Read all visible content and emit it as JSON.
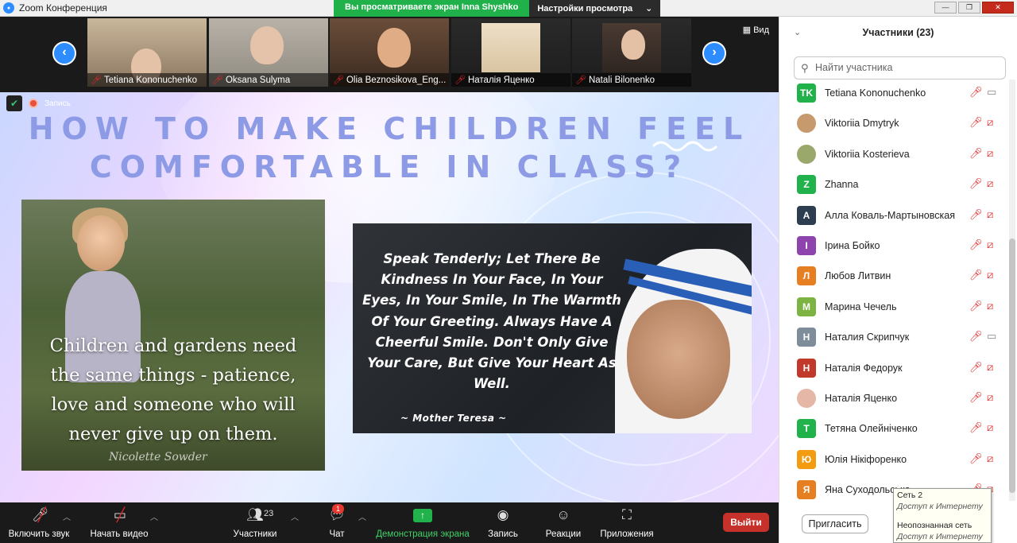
{
  "window": {
    "title": "Zoom Конференция",
    "sharing_banner": "Вы просматриваете экран Inna Shyshko",
    "view_options": "Настройки просмотра",
    "view_label": "Вид"
  },
  "video_strip": {
    "tiles": [
      {
        "name": "Tetiana Kononuchenko"
      },
      {
        "name": "Oksana Sulyma"
      },
      {
        "name": "Olia Beznosikova_Eng..."
      },
      {
        "name": "Наталія Яценко"
      },
      {
        "name": "Natali Bilonenko"
      }
    ]
  },
  "recording_label": "Запись",
  "slide": {
    "headline_line1": "HOW TO MAKE CHILDREN FEEL",
    "headline_line2": "COMFORTABLE IN CLASS?",
    "left_caption_lines": [
      "Children and gardens need",
      "the same things - patience,",
      "love and someone who will",
      "never give up on them."
    ],
    "left_signature": "Nicolette Sowder",
    "quote_lines": [
      "Speak Tenderly; Let There Be",
      "Kindness In Your Face, In Your",
      "Eyes, In Your Smile, In The Warmth",
      "Of Your Greeting. Always Have A",
      "Cheerful Smile. Don't Only Give",
      "Your Care, But Give Your Heart As",
      "Well."
    ],
    "quote_author": "~   Mother Teresa   ~"
  },
  "toolbar": {
    "mute": "Включить звук",
    "video": "Начать видео",
    "participants": "Участники",
    "participants_count": "23",
    "chat": "Чат",
    "chat_badge": "1",
    "share": "Демонстрация экрана",
    "record": "Запись",
    "reactions": "Реакции",
    "apps": "Приложения",
    "leave": "Выйти"
  },
  "participants_panel": {
    "title": "Участники (23)",
    "search_placeholder": "Найти участника",
    "invite": "Пригласить",
    "items": [
      {
        "initials": "TK",
        "name": "Tetiana Kononuchenko",
        "color": "#22b24c",
        "photo": false,
        "video_on": true
      },
      {
        "initials": "",
        "name": "Viktoriia Dmytryk",
        "color": "#c79a6e",
        "photo": true,
        "video_on": false
      },
      {
        "initials": "",
        "name": "Viktoriia Kosterieva",
        "color": "#9aa86c",
        "photo": true,
        "video_on": false
      },
      {
        "initials": "Z",
        "name": "Zhanna",
        "color": "#22b24c",
        "photo": false,
        "video_on": false
      },
      {
        "initials": "A",
        "name": "Алла Коваль-Мартыновская",
        "color": "#2c3e50",
        "photo": false,
        "video_on": false
      },
      {
        "initials": "I",
        "name": "Ірина Бойко",
        "color": "#8e44ad",
        "photo": false,
        "video_on": false
      },
      {
        "initials": "Л",
        "name": "Любов Литвин",
        "color": "#e67e22",
        "photo": false,
        "video_on": false
      },
      {
        "initials": "M",
        "name": "Марина Чечель",
        "color": "#7cb342",
        "photo": false,
        "video_on": false
      },
      {
        "initials": "Н",
        "name": "Наталия Скрипчук",
        "color": "#7f8c9a",
        "photo": false,
        "video_on": true
      },
      {
        "initials": "Н",
        "name": "Наталія Федорук",
        "color": "#c0392b",
        "photo": false,
        "video_on": false
      },
      {
        "initials": "",
        "name": "Наталія Яценко",
        "color": "#e4b7a6",
        "photo": true,
        "video_on": false
      },
      {
        "initials": "Т",
        "name": "Тетяна Олейніченко",
        "color": "#22b24c",
        "photo": false,
        "video_on": false
      },
      {
        "initials": "Ю",
        "name": "Юлія Нікіфоренко",
        "color": "#f39c12",
        "photo": false,
        "video_on": false
      },
      {
        "initials": "Я",
        "name": "Яна Суходольська",
        "color": "#e67e22",
        "photo": false,
        "video_on": false
      }
    ]
  },
  "network_tooltip": {
    "line1": "Сеть  2",
    "line2": "Доступ к Интернету",
    "line3": "Неопознанная сеть",
    "line4": "Доступ к Интернету"
  }
}
